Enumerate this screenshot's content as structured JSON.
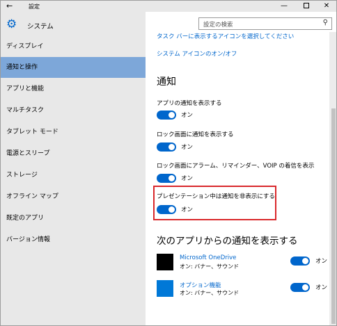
{
  "titlebar": {
    "back": "←",
    "title": "設定",
    "min": "—",
    "close": "✕"
  },
  "sidebar": {
    "header": "システム",
    "items": [
      {
        "label": "ディスプレイ"
      },
      {
        "label": "通知と操作"
      },
      {
        "label": "アプリと機能"
      },
      {
        "label": "マルチタスク"
      },
      {
        "label": "タブレット モード"
      },
      {
        "label": "電源とスリープ"
      },
      {
        "label": "ストレージ"
      },
      {
        "label": "オフライン マップ"
      },
      {
        "label": "既定のアプリ"
      },
      {
        "label": "バージョン情報"
      }
    ],
    "active_index": 1
  },
  "search": {
    "placeholder": "設定の検索"
  },
  "content": {
    "top_link": "タスク バーに表示するアイコンを選択してください",
    "system_icons_link": "システム アイコンのオン/オフ",
    "notifications_heading": "通知",
    "settings": [
      {
        "label": "アプリの通知を表示する",
        "state": "オン"
      },
      {
        "label": "ロック画面に通知を表示する",
        "state": "オン"
      },
      {
        "label": "ロック画面にアラーム、リマインダー、VOIP の着信を表示",
        "state": "オン"
      },
      {
        "label": "プレゼンテーション中は通知を非表示にする",
        "state": "オン"
      }
    ],
    "apps_heading": "次のアプリからの通知を表示する",
    "apps": [
      {
        "name": "Microsoft OneDrive",
        "sub": "オン: バナー、サウンド",
        "state": "オン",
        "icon_color": "#000000"
      },
      {
        "name": "オプション機能",
        "sub": "オン: バナー、サウンド",
        "state": "オン",
        "icon_color": "#0078d7"
      }
    ]
  },
  "colors": {
    "accent": "#0066cc",
    "highlight_border": "#d9262a",
    "active_nav": "#7da7d9"
  }
}
